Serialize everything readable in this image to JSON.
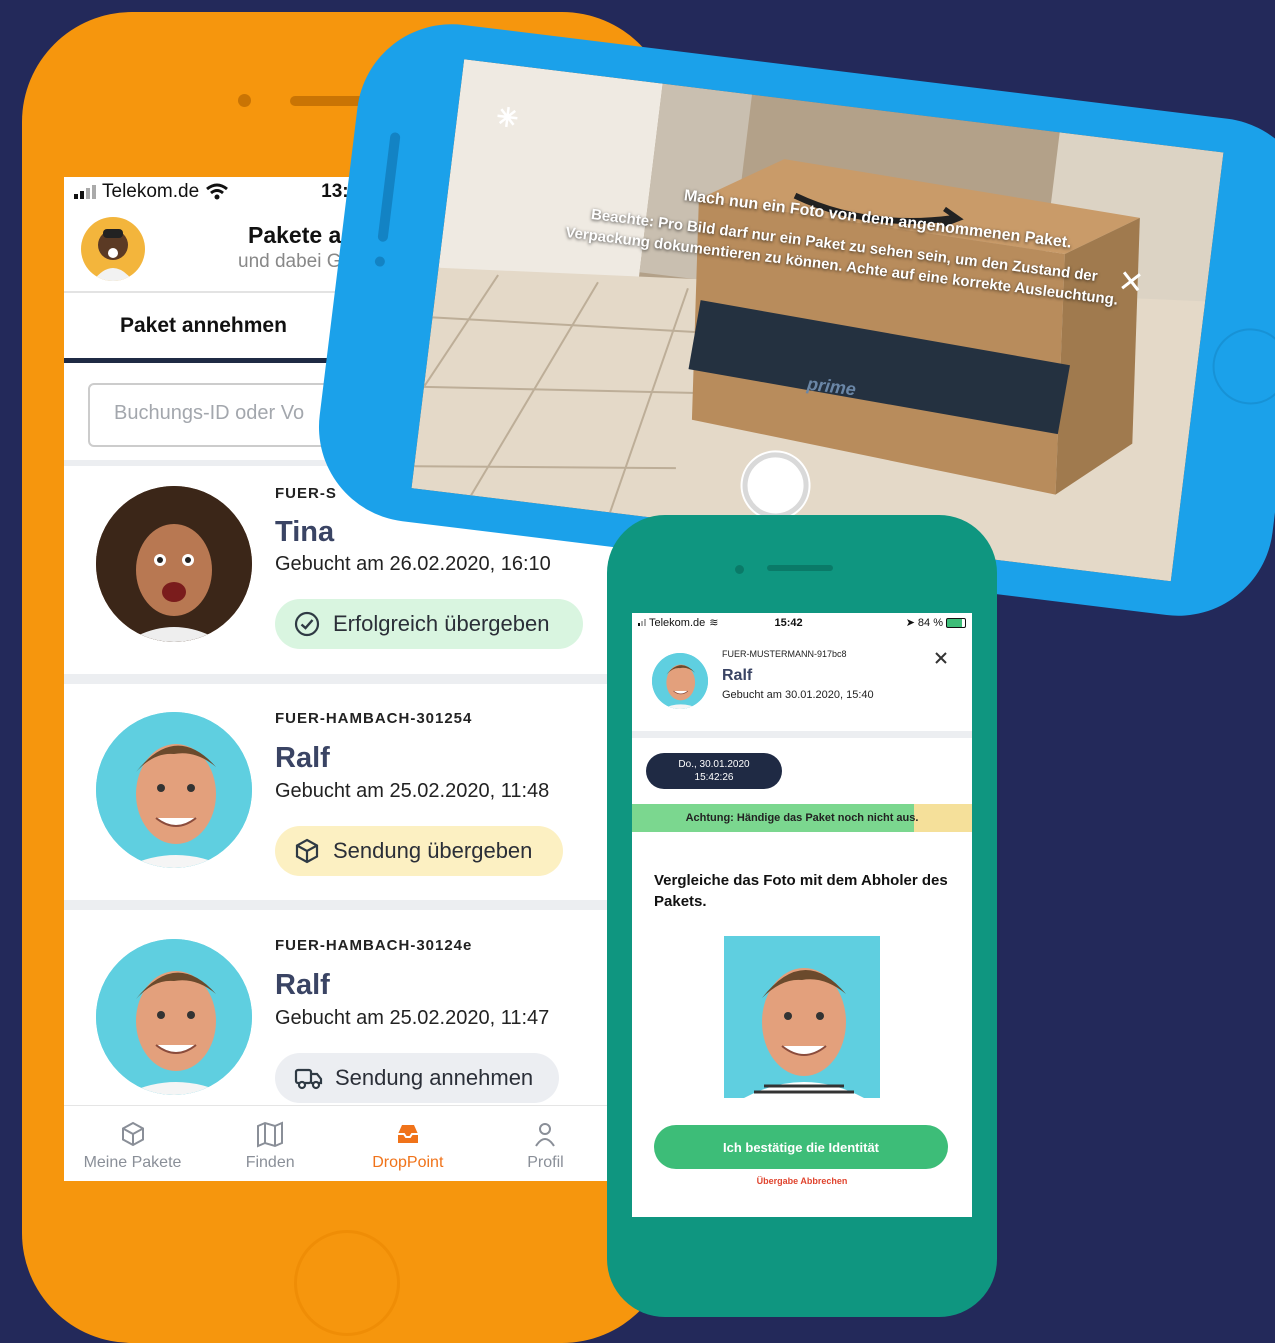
{
  "colors": {
    "background": "#23295a",
    "phone_orange": "#f6960d",
    "phone_blue": "#1ba1ea",
    "phone_green": "#0f9680",
    "accent_orange": "#f0731a",
    "success_green": "#3dbd78",
    "warning_yellow": "#f5e09a",
    "cancel_red": "#e0452f"
  },
  "orange_app": {
    "status": {
      "carrier": "Telekom.de",
      "time": "13:1"
    },
    "header": {
      "title": "Pakete an",
      "subtitle": "und dabei Ge"
    },
    "tab": "Paket annehmen",
    "search_placeholder": "Buchungs-ID oder Vo",
    "cards": [
      {
        "id": "FUER-S",
        "name": "Tina",
        "date": "Gebucht am 26.02.2020, 16:10",
        "status": "Erfolgreich übergeben",
        "status_icon": "check-circle-icon",
        "pill_color": "#d9f5e0"
      },
      {
        "id": "FUER-HAMBACH-301254",
        "name": "Ralf",
        "date": "Gebucht am 25.02.2020, 11:48",
        "status": "Sendung übergeben",
        "status_icon": "package-icon",
        "pill_color": "#fcf0c2"
      },
      {
        "id": "FUER-HAMBACH-30124e",
        "name": "Ralf",
        "date": "Gebucht am 25.02.2020, 11:47",
        "status": "Sendung annehmen",
        "status_icon": "truck-icon",
        "pill_color": "#eceef2"
      }
    ],
    "nav": [
      {
        "label": "Meine Pakete",
        "icon": "package-icon"
      },
      {
        "label": "Finden",
        "icon": "map-icon"
      },
      {
        "label": "DropPoint",
        "icon": "inbox-icon",
        "active": true
      },
      {
        "label": "Profil",
        "icon": "user-icon"
      }
    ]
  },
  "camera_app": {
    "instruction_1": "Mach nun ein Foto von dem angenommenen Paket.",
    "instruction_2": "Beachte: Pro Bild darf nur ein Paket zu sehen sein, um den Zustand der Verpackung dokumentieren zu können. Achte auf eine korrekte Ausleuchtung.",
    "box_label": "prime",
    "close_icon": "close-icon",
    "flash_icon": "flash-icon"
  },
  "green_app": {
    "status": {
      "carrier": "Telekom.de",
      "time": "15:42",
      "battery": "84 %"
    },
    "booking_id": "FUER-MUSTERMANN-917bc8",
    "name": "Ralf",
    "date": "Gebucht am 30.01.2020, 15:40",
    "timestamp_line1": "Do., 30.01.2020",
    "timestamp_line2": "15:42:26",
    "warning": "Achtung: Händige das Paket noch nicht aus.",
    "warning_progress": 0.83,
    "compare_text": "Vergleiche das Foto mit dem Abholer des Pakets.",
    "confirm_button": "Ich bestätige die Identität",
    "cancel_link": "Übergabe Abbrechen"
  }
}
